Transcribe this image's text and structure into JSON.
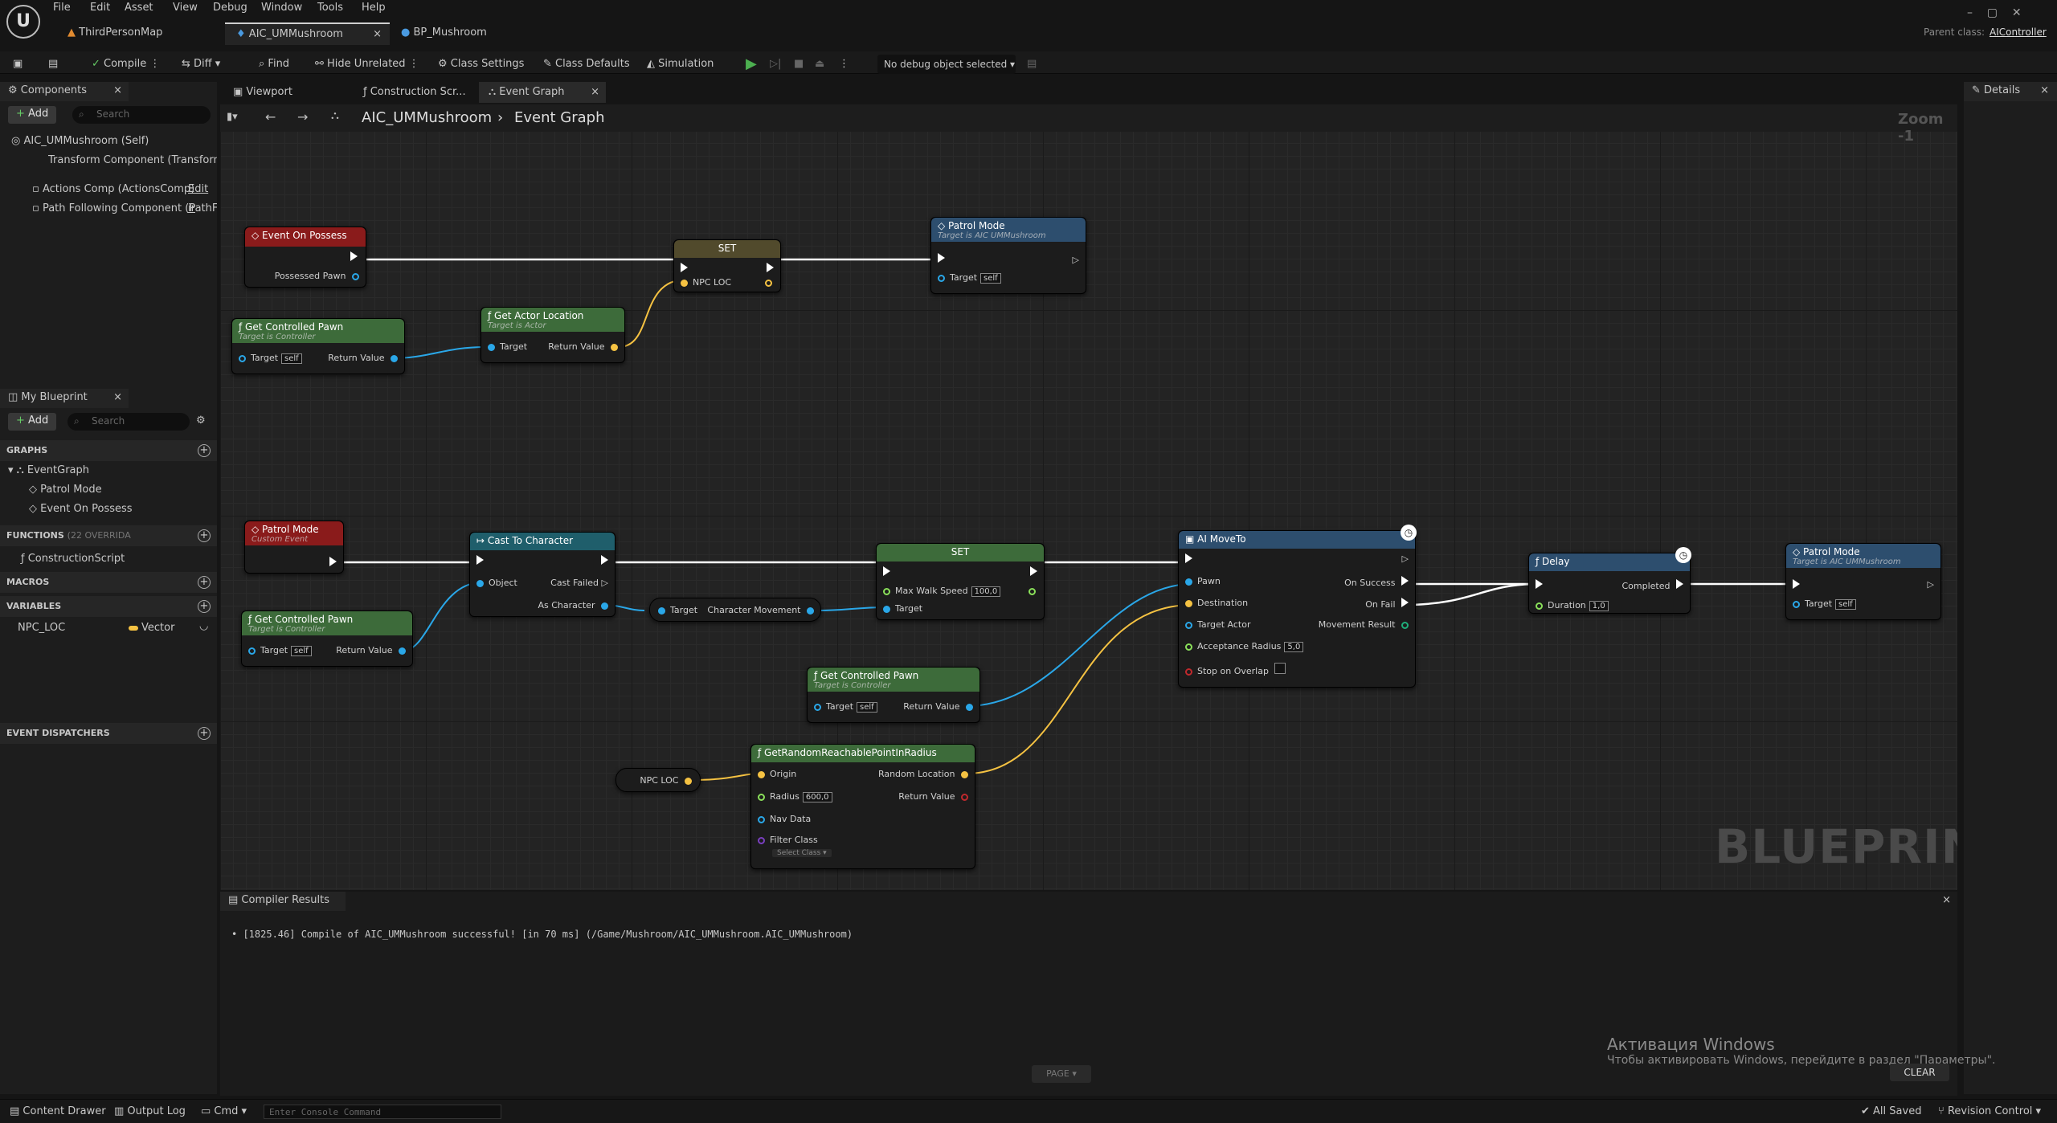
{
  "menu": [
    "File",
    "Edit",
    "Asset",
    "View",
    "Debug",
    "Window",
    "Tools",
    "Help"
  ],
  "doc_tabs": [
    "ThirdPersonMap",
    "AIC_UMMushroom",
    "BP_Mushroom"
  ],
  "parent_class_label": "Parent class:",
  "parent_class_value": "AIController",
  "toolbar": {
    "compile": "Compile",
    "diff": "Diff",
    "find": "Find",
    "hide_unrelated": "Hide Unrelated",
    "class_settings": "Class Settings",
    "class_defaults": "Class Defaults",
    "simulation": "Simulation",
    "debug_select": "No debug object selected"
  },
  "components": {
    "title": "Components",
    "add": "Add",
    "search_placeholder": "Search",
    "items": [
      "AIC_UMMushroom (Self)",
      "Transform Component (TransformC",
      "Actions Comp (ActionsComp)",
      "Edit ir",
      "Path Following Component (PathFolk"
    ]
  },
  "my_blueprint": {
    "title": "My Blueprint",
    "add": "Add",
    "search_placeholder": "Search",
    "graphs_label": "GRAPHS",
    "graphs": [
      "EventGraph",
      "Patrol Mode",
      "Event On Possess"
    ],
    "functions_label": "FUNCTIONS",
    "functions_count": "(22 OVERRIDA",
    "functions": [
      "ConstructionScript"
    ],
    "macros_label": "MACROS",
    "variables_label": "VARIABLES",
    "variables": [
      {
        "name": "NPC_LOC",
        "type": "Vector"
      }
    ],
    "dispatchers_label": "EVENT DISPATCHERS"
  },
  "graph_tabs": [
    "Viewport",
    "Construction Scr...",
    "Event Graph"
  ],
  "breadcrumb": {
    "root": "AIC_UMMushroom",
    "current": "Event Graph"
  },
  "zoom": "Zoom -1",
  "watermark": "BLUEPRINT",
  "details_title": "Details",
  "nodes": {
    "event_on_possess": {
      "title": "Event On Possess",
      "pin": "Possessed Pawn"
    },
    "set1": {
      "title": "SET",
      "pin": "NPC LOC"
    },
    "patrol1": {
      "title": "Patrol Mode",
      "sub": "Target is AIC UMMushroom",
      "pin": "Target",
      "val": "self"
    },
    "gcp1": {
      "title": "Get Controlled Pawn",
      "sub": "Target is Controller",
      "target": "Target",
      "val": "self",
      "ret": "Return Value"
    },
    "gal": {
      "title": "Get Actor Location",
      "sub": "Target is Actor",
      "target": "Target",
      "ret": "Return Value"
    },
    "patrol_event": {
      "title": "Patrol Mode",
      "sub": "Custom Event"
    },
    "cast": {
      "title": "Cast To Character",
      "object": "Object",
      "failed": "Cast Failed",
      "as": "As Character"
    },
    "charmove": {
      "target": "Target",
      "out": "Character Movement"
    },
    "set2": {
      "title": "SET",
      "pin": "Max Walk Speed",
      "val": "100,0",
      "target": "Target"
    },
    "gcp2": {
      "title": "Get Controlled Pawn",
      "sub": "Target is Controller",
      "target": "Target",
      "val": "self",
      "ret": "Return Value"
    },
    "gcp3": {
      "title": "Get Controlled Pawn",
      "sub": "Target is Controller",
      "target": "Target",
      "val": "self",
      "ret": "Return Value"
    },
    "moveto": {
      "title": "AI MoveTo",
      "pawn": "Pawn",
      "dest": "Destination",
      "tactor": "Target Actor",
      "radius": "Acceptance Radius",
      "radius_val": "5,0",
      "stop": "Stop on Overlap",
      "success": "On Success",
      "fail": "On Fail",
      "result": "Movement Result"
    },
    "delay": {
      "title": "Delay",
      "dur": "Duration",
      "dur_val": "1,0",
      "completed": "Completed"
    },
    "patrol2": {
      "title": "Patrol Mode",
      "sub": "Target is AIC UMMushroom",
      "pin": "Target",
      "val": "self"
    },
    "npcloc": {
      "title": "NPC LOC"
    },
    "grr": {
      "title": "GetRandomReachablePointInRadius",
      "origin": "Origin",
      "radius": "Radius",
      "radius_val": "600,0",
      "nav": "Nav Data",
      "filter": "Filter Class",
      "filter_val": "Select Class",
      "rloc": "Random Location",
      "ret": "Return Value"
    }
  },
  "compiler": {
    "title": "Compiler Results",
    "message": "[1825.46] Compile of AIC_UMMushroom successful! [in 70 ms] (/Game/Mushroom/AIC_UMMushroom.AIC_UMMushroom)",
    "page": "PAGE",
    "clear": "CLEAR"
  },
  "activation": {
    "title": "Активация Windows",
    "body": "Чтобы активировать Windows, перейдите в раздел \"Параметры\"."
  },
  "status": {
    "content_drawer": "Content Drawer",
    "output_log": "Output Log",
    "cmd": "Cmd",
    "console_placeholder": "Enter Console Command",
    "saved": "All Saved",
    "revision": "Revision Control"
  },
  "colors": {
    "exec": "#ffffff",
    "vector": "#f5c242",
    "object": "#2aa7e8",
    "float": "#8ae05a",
    "event_red": "#8a1b1b",
    "func_green": "#3d6b3a",
    "cast_teal": "#1f5e6b",
    "blue_node": "#2d4e6e"
  }
}
